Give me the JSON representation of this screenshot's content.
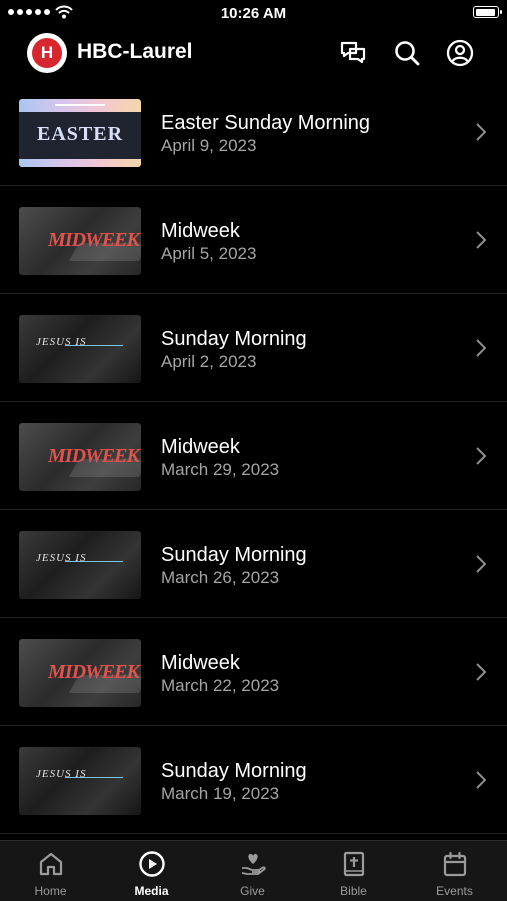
{
  "status_bar": {
    "time": "10:26 AM"
  },
  "header": {
    "logo_letter": "H",
    "title": "HBC-Laurel"
  },
  "thumbnail_text": {
    "easter": "EASTER",
    "midweek": "MIDWEEK",
    "jesus_is": "JESUS IS"
  },
  "media_items": [
    {
      "title": "Easter Sunday Morning",
      "date": "April 9, 2023",
      "thumbnail": "easter"
    },
    {
      "title": "Midweek",
      "date": "April 5, 2023",
      "thumbnail": "midweek"
    },
    {
      "title": "Sunday Morning",
      "date": "April 2, 2023",
      "thumbnail": "jesus-is"
    },
    {
      "title": "Midweek",
      "date": "March 29, 2023",
      "thumbnail": "midweek"
    },
    {
      "title": "Sunday Morning",
      "date": "March 26, 2023",
      "thumbnail": "jesus-is"
    },
    {
      "title": "Midweek",
      "date": "March 22, 2023",
      "thumbnail": "midweek"
    },
    {
      "title": "Sunday Morning",
      "date": "March 19, 2023",
      "thumbnail": "jesus-is"
    }
  ],
  "tab_bar": {
    "tabs": [
      {
        "label": "Home",
        "icon": "home-icon"
      },
      {
        "label": "Media",
        "icon": "play-circle-icon",
        "active": true
      },
      {
        "label": "Give",
        "icon": "give-hand-heart-icon"
      },
      {
        "label": "Bible",
        "icon": "bible-icon"
      },
      {
        "label": "Events",
        "icon": "calendar-icon"
      }
    ]
  },
  "colors": {
    "background": "#000000",
    "accent": "#d8262e",
    "secondary_text": "#a5a5a5",
    "tab_bar": "#161616"
  }
}
